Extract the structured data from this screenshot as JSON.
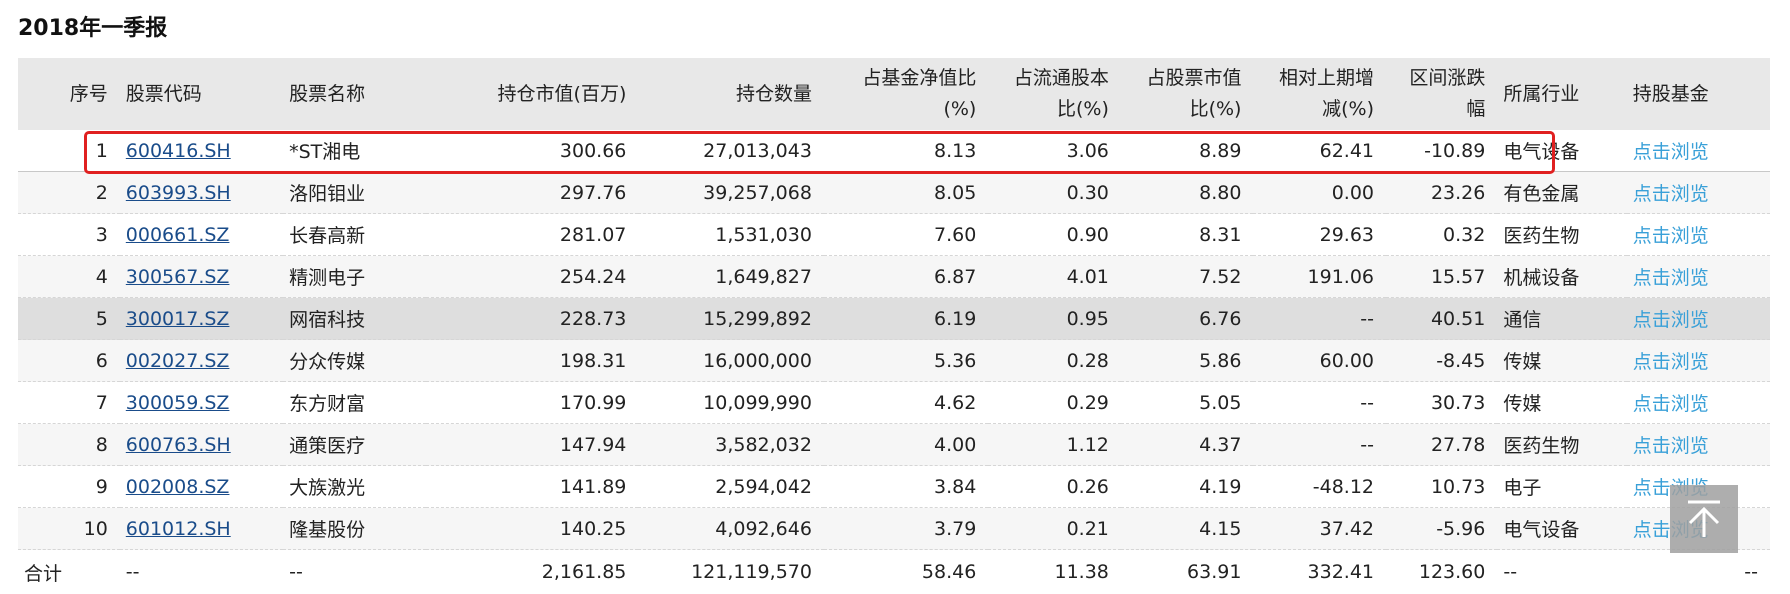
{
  "title": "2018年一季报",
  "headers": {
    "seq": "序号",
    "code": "股票代码",
    "name": "股票名称",
    "value": "持仓市值(百万)",
    "qty": "持仓数量",
    "nav_pct_l1": "占基金净值比",
    "nav_pct_l2": "(%)",
    "float_pct_l1": "占流通股本",
    "float_pct_l2": "比(%)",
    "stock_pct_l1": "占股票市值",
    "stock_pct_l2": "比(%)",
    "change_l1": "相对上期增",
    "change_l2": "减(%)",
    "range_l1": "区间涨跌",
    "range_l2": "幅",
    "industry": "所属行业",
    "fund": "持股基金"
  },
  "rows": [
    {
      "seq": "1",
      "code": "600416.SH",
      "name": "*ST湘电",
      "value": "300.66",
      "qty": "27,013,043",
      "nav_pct": "8.13",
      "float_pct": "3.06",
      "stock_pct": "8.89",
      "change": "62.41",
      "range": "-10.89",
      "industry": "电气设备",
      "link": "点击浏览"
    },
    {
      "seq": "2",
      "code": "603993.SH",
      "name": "洛阳钼业",
      "value": "297.76",
      "qty": "39,257,068",
      "nav_pct": "8.05",
      "float_pct": "0.30",
      "stock_pct": "8.80",
      "change": "0.00",
      "range": "23.26",
      "industry": "有色金属",
      "link": "点击浏览"
    },
    {
      "seq": "3",
      "code": "000661.SZ",
      "name": "长春高新",
      "value": "281.07",
      "qty": "1,531,030",
      "nav_pct": "7.60",
      "float_pct": "0.90",
      "stock_pct": "8.31",
      "change": "29.63",
      "range": "0.32",
      "industry": "医药生物",
      "link": "点击浏览"
    },
    {
      "seq": "4",
      "code": "300567.SZ",
      "name": "精测电子",
      "value": "254.24",
      "qty": "1,649,827",
      "nav_pct": "6.87",
      "float_pct": "4.01",
      "stock_pct": "7.52",
      "change": "191.06",
      "range": "15.57",
      "industry": "机械设备",
      "link": "点击浏览"
    },
    {
      "seq": "5",
      "code": "300017.SZ",
      "name": "网宿科技",
      "value": "228.73",
      "qty": "15,299,892",
      "nav_pct": "6.19",
      "float_pct": "0.95",
      "stock_pct": "6.76",
      "change": "--",
      "range": "40.51",
      "industry": "通信",
      "link": "点击浏览"
    },
    {
      "seq": "6",
      "code": "002027.SZ",
      "name": "分众传媒",
      "value": "198.31",
      "qty": "16,000,000",
      "nav_pct": "5.36",
      "float_pct": "0.28",
      "stock_pct": "5.86",
      "change": "60.00",
      "range": "-8.45",
      "industry": "传媒",
      "link": "点击浏览"
    },
    {
      "seq": "7",
      "code": "300059.SZ",
      "name": "东方财富",
      "value": "170.99",
      "qty": "10,099,990",
      "nav_pct": "4.62",
      "float_pct": "0.29",
      "stock_pct": "5.05",
      "change": "--",
      "range": "30.73",
      "industry": "传媒",
      "link": "点击浏览"
    },
    {
      "seq": "8",
      "code": "600763.SH",
      "name": "通策医疗",
      "value": "147.94",
      "qty": "3,582,032",
      "nav_pct": "4.00",
      "float_pct": "1.12",
      "stock_pct": "4.37",
      "change": "--",
      "range": "27.78",
      "industry": "医药生物",
      "link": "点击浏览"
    },
    {
      "seq": "9",
      "code": "002008.SZ",
      "name": "大族激光",
      "value": "141.89",
      "qty": "2,594,042",
      "nav_pct": "3.84",
      "float_pct": "0.26",
      "stock_pct": "4.19",
      "change": "-48.12",
      "range": "10.73",
      "industry": "电子",
      "link": "点击浏览"
    },
    {
      "seq": "10",
      "code": "601012.SH",
      "name": "隆基股份",
      "value": "140.25",
      "qty": "4,092,646",
      "nav_pct": "3.79",
      "float_pct": "0.21",
      "stock_pct": "4.15",
      "change": "37.42",
      "range": "-5.96",
      "industry": "电气设备",
      "link": "点击浏览"
    }
  ],
  "total": {
    "label": "合计",
    "code": "--",
    "name": "--",
    "value": "2,161.85",
    "qty": "121,119,570",
    "nav_pct": "58.46",
    "float_pct": "11.38",
    "stock_pct": "63.91",
    "change": "332.41",
    "range": "123.60",
    "industry": "--",
    "fund": "--"
  },
  "colors": {
    "header_bg": "#e8e8e8",
    "link": "#1a4c8a",
    "browse_link": "#39a0d8",
    "highlight_border": "#e02020"
  },
  "icons": {
    "back_to_top": "arrow-up-icon"
  }
}
